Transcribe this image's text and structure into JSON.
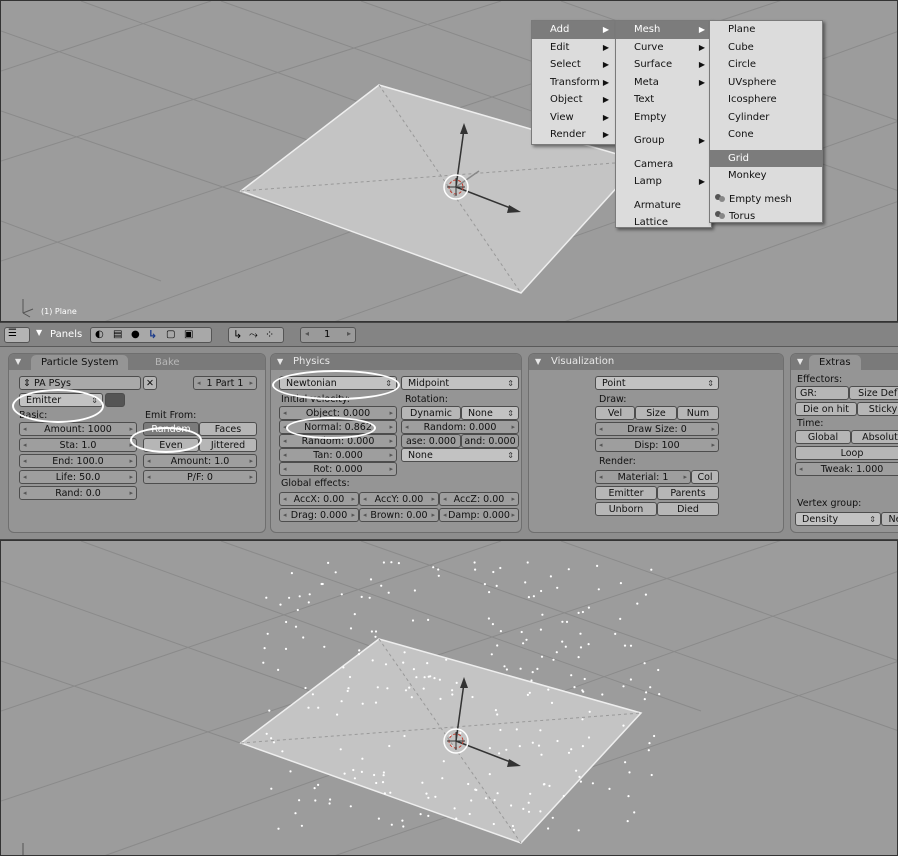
{
  "top_viewport": {
    "object_label": "(1) Plane"
  },
  "add_menu": {
    "items": [
      {
        "label": "Add",
        "active": true,
        "submenu": true
      },
      {
        "label": "Edit",
        "submenu": true
      },
      {
        "label": "Select",
        "submenu": true
      },
      {
        "label": "Transform",
        "submenu": true
      },
      {
        "label": "Object",
        "submenu": true
      },
      {
        "label": "View",
        "submenu": true
      },
      {
        "label": "Render",
        "submenu": true
      }
    ]
  },
  "add_submenu": {
    "mesh": "Mesh",
    "curve": "Curve",
    "surface": "Surface",
    "meta": "Meta",
    "text": "Text",
    "empty": "Empty",
    "group": "Group",
    "camera": "Camera",
    "lamp": "Lamp",
    "armature": "Armature",
    "lattice": "Lattice"
  },
  "mesh_submenu": {
    "plane": "Plane",
    "cube": "Cube",
    "circle": "Circle",
    "uvsphere": "UVsphere",
    "icosphere": "Icosphere",
    "cylinder": "Cylinder",
    "cone": "Cone",
    "grid": "Grid",
    "monkey": "Monkey",
    "empty_mesh": "Empty mesh",
    "torus": "Torus",
    "highlighted": "Grid"
  },
  "header": {
    "panels_label": "Panels",
    "frame": "1"
  },
  "particle_panel": {
    "tab": "Particle System",
    "tab2": "Bake",
    "psys_name": "PA PSys",
    "part": "1 Part 1",
    "type": "Emitter",
    "basic_label": "Basic:",
    "amount": "Amount: 1000",
    "sta": "Sta: 1.0",
    "end": "End: 100.0",
    "life": "Life: 50.0",
    "rand": "Rand: 0.0",
    "emit_from_label": "Emit From:",
    "random": "Random",
    "faces": "Faces",
    "even": "Even",
    "jittered": "Jittered",
    "jit_amount": "Amount: 1.0",
    "pf": "P/F: 0"
  },
  "physics_panel": {
    "title": "Physics",
    "physics_type": "Newtonian",
    "integrator": "Midpoint",
    "init_vel_label": "Initial velocity:",
    "object": "Object: 0.000",
    "normal": "Normal: 0.862",
    "random": "Random: 0.000",
    "tan": "Tan: 0.000",
    "rot": "Rot: 0.000",
    "rotation_label": "Rotation:",
    "dynamic": "Dynamic",
    "rot_none": "None",
    "rot_random": "Random: 0.000",
    "phase": "ase: 0.000",
    "and": "and: 0.000",
    "ang_none": "None",
    "global_label": "Global effects:",
    "accx": "AccX: 0.00",
    "accy": "AccY: 0.00",
    "accz": "AccZ: 0.00",
    "drag": "Drag: 0.000",
    "brown": "Brown: 0.00",
    "damp": "Damp: 0.000"
  },
  "vis_panel": {
    "title": "Visualization",
    "draw_type": "Point",
    "draw_label": "Draw:",
    "vel": "Vel",
    "size": "Size",
    "num": "Num",
    "draw_size": "Draw Size: 0",
    "disp": "Disp: 100",
    "render_label": "Render:",
    "material": "Material: 1",
    "col": "Col",
    "emitter": "Emitter",
    "parents": "Parents",
    "unborn": "Unborn",
    "died": "Died"
  },
  "extras_panel": {
    "title": "Extras",
    "effectors_label": "Effectors:",
    "gr": "GR:",
    "size_defl": "Size Defl",
    "die_on_hit": "Die on hit",
    "sticky": "Sticky",
    "time_label": "Time:",
    "global": "Global",
    "absolute": "Absolut",
    "loop": "Loop",
    "tweak": "Tweak: 1.000",
    "vgroup_label": "Vertex group:",
    "density": "Density",
    "neg": "Ne"
  }
}
